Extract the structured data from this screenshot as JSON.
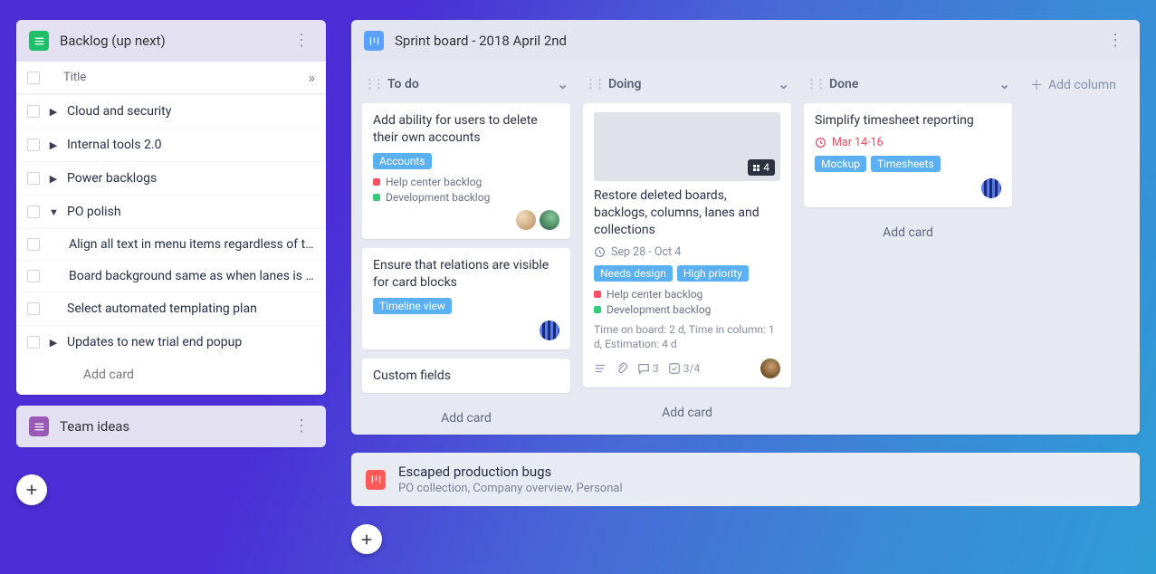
{
  "left": {
    "backlog": {
      "title": "Backlog (up next)",
      "columnHeader": "Title",
      "addCard": "Add card",
      "items": [
        {
          "label": "Cloud and security",
          "expandable": true,
          "expanded": false
        },
        {
          "label": "Internal tools 2.0",
          "expandable": true,
          "expanded": false
        },
        {
          "label": "Power backlogs",
          "expandable": true,
          "expanded": false
        },
        {
          "label": "PO polish",
          "expandable": true,
          "expanded": true,
          "children": [
            "Align all text in menu items regardless of them…",
            "Board background same as when lanes is enab…"
          ]
        },
        {
          "label": "Select automated templating plan",
          "expandable": false
        },
        {
          "label": "Updates to new trial end popup",
          "expandable": true,
          "expanded": false
        }
      ]
    },
    "teamIdeas": {
      "title": "Team ideas"
    }
  },
  "board": {
    "title": "Sprint board - 2018 April 2nd",
    "addColumn": "Add column",
    "lanes": [
      {
        "name": "To do",
        "addCard": "Add card",
        "cards": [
          {
            "title": "Add ability for users to delete their own accounts",
            "tags": [
              "Accounts"
            ],
            "links": [
              {
                "color": "red",
                "label": "Help center backlog"
              },
              {
                "color": "green",
                "label": "Development backlog"
              }
            ],
            "avatars": [
              "a1",
              "a2"
            ]
          },
          {
            "title": "Ensure that relations are visible for card blocks",
            "tags": [
              "Timeline view"
            ],
            "avatars": [
              "striped"
            ]
          },
          {
            "title": "Custom fields"
          }
        ]
      },
      {
        "name": "Doing",
        "addCard": "Add card",
        "cards": [
          {
            "cover": true,
            "coverBadgeCount": "4",
            "title": "Restore deleted boards, backlogs, columns, lanes and collections",
            "date": "Sep 28 - Oct 4",
            "tags": [
              "Needs design",
              "High priority"
            ],
            "links": [
              {
                "color": "red",
                "label": "Help center backlog"
              },
              {
                "color": "green",
                "label": "Development backlog"
              }
            ],
            "time": "Time on board: 2 d, Time in column: 1 d, Estimation: 4 d",
            "meta": {
              "comments": "3",
              "checklist": "3/4"
            },
            "avatars": [
              "a3"
            ]
          }
        ]
      },
      {
        "name": "Done",
        "addCard": "Add card",
        "cards": [
          {
            "title": "Simplify timesheet reporting",
            "date": "Mar 14-16",
            "dateOverdue": true,
            "tags": [
              "Mockup",
              "Timesheets"
            ],
            "avatars": [
              "striped"
            ]
          }
        ]
      }
    ]
  },
  "bottom": {
    "title": "Escaped production bugs",
    "sub": "PO collection, Company overview, Personal"
  }
}
